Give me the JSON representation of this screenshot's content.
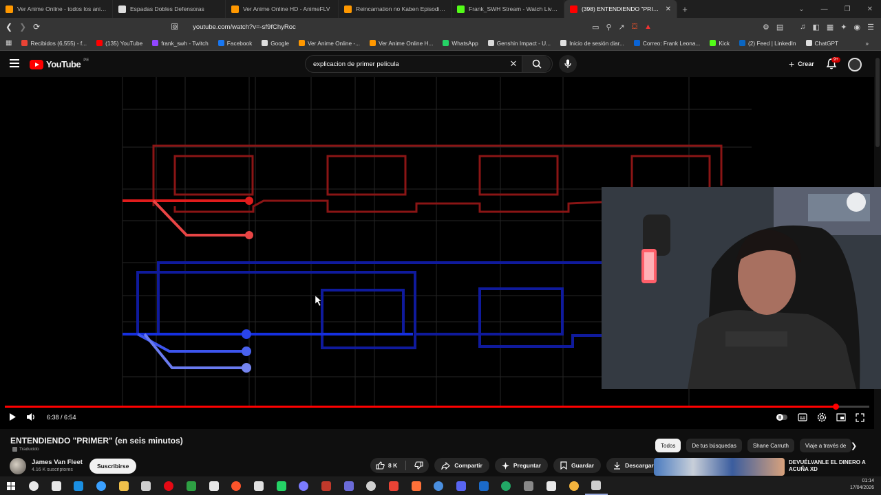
{
  "browser": {
    "tabs": [
      {
        "title": "Ver Anime Online - todos los anime",
        "color": "#ff9800"
      },
      {
        "title": "Espadas Dobles Defensoras",
        "color": "#dddddd"
      },
      {
        "title": "Ver Anime Online HD - AnimeFLV",
        "color": "#ff9800"
      },
      {
        "title": "Reincarnation no Kaben Episodio 3 S",
        "color": "#ff9800"
      },
      {
        "title": "Frank_SWH Stream - Watch Live on",
        "color": "#53fc18"
      },
      {
        "title": "(398) ENTENDIENDO \"PRIMER\"",
        "color": "#ff0000",
        "active": true
      }
    ],
    "url": "youtube.com/watch?v=-sf9fChyRoc",
    "bookmarks": [
      {
        "label": "Recibidos (6,555) - f...",
        "color": "#ea4335"
      },
      {
        "label": "(135) YouTube",
        "color": "#ff0000"
      },
      {
        "label": "frank_swh - Twitch",
        "color": "#9146ff"
      },
      {
        "label": "Facebook",
        "color": "#1877f2"
      },
      {
        "label": "Google",
        "color": "#dddddd"
      },
      {
        "label": "Ver Anime Online -...",
        "color": "#ff9800"
      },
      {
        "label": "Ver Anime Online H...",
        "color": "#ff9800"
      },
      {
        "label": "WhatsApp",
        "color": "#25d366"
      },
      {
        "label": "Genshin Impact - U...",
        "color": "#d9d9d9"
      },
      {
        "label": "Inicio de sesión diar...",
        "color": "#e0e0e0"
      },
      {
        "label": "Correo: Frank Leona...",
        "color": "#0a64d6"
      },
      {
        "label": "Kick",
        "color": "#53fc18"
      },
      {
        "label": "(2) Feed | LinkedIn",
        "color": "#0a66c2"
      },
      {
        "label": "ChatGPT",
        "color": "#dddddd"
      }
    ]
  },
  "youtube": {
    "logo_text": "YouTube",
    "country": "PE",
    "search_value": "explicacion de primer pelicula",
    "create_label": "Crear",
    "notifications": "9+"
  },
  "player": {
    "time": "6:38 / 6:54",
    "progress": 0.961
  },
  "video": {
    "title": "ENTENDIENDO \"PRIMER\" (en seis minutos)",
    "translated": "Traducido",
    "channel": "James Van Fleet",
    "subscribers": "4.16 K suscriptores",
    "subscribe_label": "Suscribirse",
    "likes": "8 K",
    "share": "Compartir",
    "ask": "Preguntar",
    "save": "Guardar",
    "download": "Descargar"
  },
  "chips": [
    "Todos",
    "De tus búsquedas",
    "Shane Carruth",
    "Viaje a través de"
  ],
  "recommended": {
    "title": "DEVUÉLVANLE EL DINERO A ACUÑA XD"
  },
  "clock": {
    "time": "01:14",
    "date": "17/04/2026"
  },
  "taskbar_icons": [
    "#e8e8e8",
    "#e8e8e8",
    "#e8e8e8",
    "#1a8fe3",
    "#3aa0ff",
    "#f0c04a",
    "#d0d0d0",
    "#e50914",
    "#2ea043",
    "#e8e8e8",
    "#fb542b",
    "#e0e0e0",
    "#25d366",
    "#7b7bff",
    "#c0392b",
    "#6b6bd8",
    "#d0d0d0",
    "#ea4335",
    "#ff7139",
    "#4a8fe0",
    "#5865f2",
    "#1b6ac9",
    "#22a866",
    "#888888",
    "#e8e8e8",
    "#f3b33d",
    "#d0d0d0"
  ]
}
